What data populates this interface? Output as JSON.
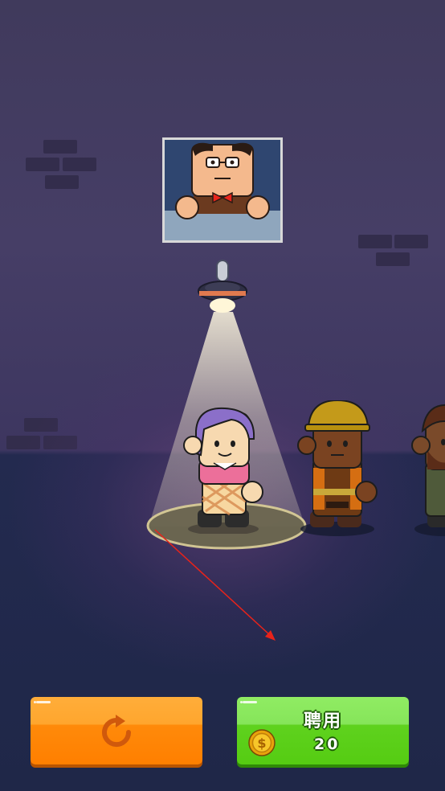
{
  "scene": {
    "background_color": "#403a5c",
    "floor_color": "#1f2748"
  },
  "portrait": {
    "icon": "boss-portrait-icon"
  },
  "candidates": [
    {
      "name": "purple-hair-girl",
      "selected": true
    },
    {
      "name": "construction-worker",
      "selected": false
    },
    {
      "name": "bearded-man",
      "selected": false
    }
  ],
  "buttons": {
    "reroll": {
      "icon": "refresh-icon",
      "color": "#ff8a0a"
    },
    "hire": {
      "label": "聘用",
      "price": "20",
      "currency_icon": "coin-icon",
      "color": "#5fd21e"
    }
  },
  "tutorial": {
    "arrow_color": "#e8231a"
  }
}
